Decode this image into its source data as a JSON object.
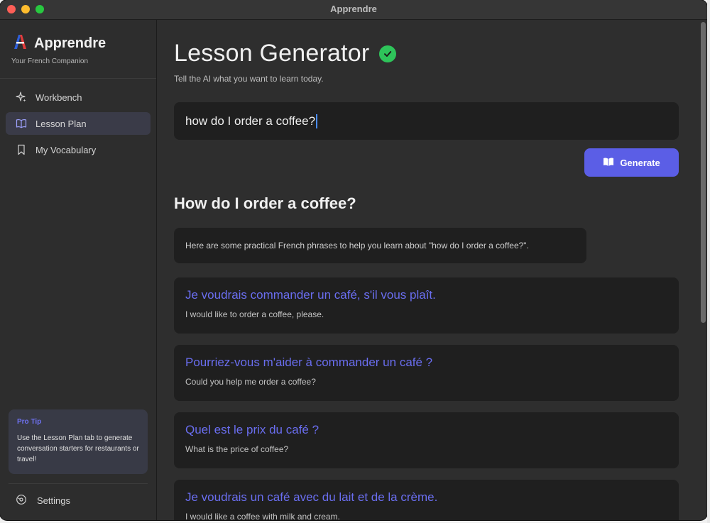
{
  "window": {
    "title": "Apprendre"
  },
  "sidebar": {
    "brand_name": "Apprendre",
    "brand_tagline": "Your French Companion",
    "items": [
      {
        "label": "Workbench",
        "icon": "sparkle-icon",
        "active": false
      },
      {
        "label": "Lesson Plan",
        "icon": "book-open-icon",
        "active": true
      },
      {
        "label": "My Vocabulary",
        "icon": "bookmark-icon",
        "active": false
      }
    ],
    "tip": {
      "title": "Pro Tip",
      "body": "Use the Lesson Plan tab to generate conversation starters for restaurants or travel!"
    },
    "settings_label": "Settings"
  },
  "main": {
    "title": "Lesson Generator",
    "subtitle": "Tell the AI what you want to learn today.",
    "input_value": "how do I order a coffee?",
    "generate_label": "Generate",
    "lesson_heading": "How do I order a coffee?",
    "intro_text": "Here are some practical French phrases to help you learn about \"how do I order a coffee?\".",
    "phrases": [
      {
        "fr": "Je voudrais commander un café, s'il vous plaît.",
        "en": "I would like to order a coffee, please."
      },
      {
        "fr": "Pourriez-vous m'aider à commander un café ?",
        "en": "Could you help me order a coffee?"
      },
      {
        "fr": "Quel est le prix du café ?",
        "en": "What is the price of coffee?"
      },
      {
        "fr": "Je voudrais un café avec du lait et de la crème.",
        "en": "I would like a coffee with milk and cream."
      }
    ]
  },
  "colors": {
    "accent": "#5b5ee6",
    "phrase_text": "#6a6ef0",
    "success": "#2ec45a"
  }
}
